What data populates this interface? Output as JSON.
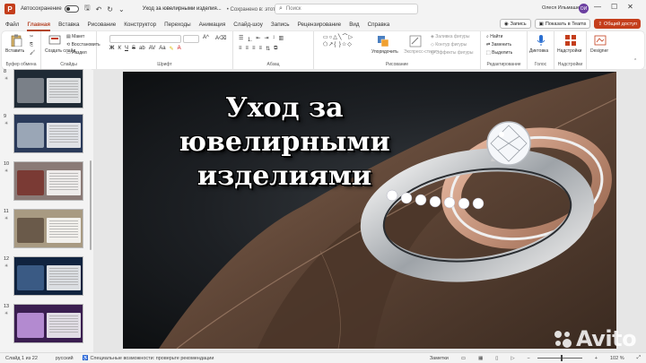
{
  "titlebar": {
    "autosave_label": "Автосохранение",
    "doc_title": "Уход за ювелирными изделия...",
    "save_state": "• Сохранено в: этот компьютер ∨",
    "search_placeholder": "Поиск",
    "user_name": "Олеся Ильмашенко",
    "avatar_initials": "ОИ"
  },
  "tabs": [
    "Файл",
    "Главная",
    "Вставка",
    "Рисование",
    "Конструктор",
    "Переходы",
    "Анимация",
    "Слайд-шоу",
    "Запись",
    "Рецензирование",
    "Вид",
    "Справка"
  ],
  "active_tab": "Главная",
  "top_buttons": {
    "record": "Запись",
    "present": "Показать в Teams",
    "share": "Общий доступ"
  },
  "ribbon": {
    "groups": {
      "clipboard": "Буфер обмена",
      "slides": "Слайды",
      "font": "Шрифт",
      "paragraph": "Абзац",
      "drawing": "Рисование",
      "editing": "Редактирование",
      "voice": "Голос",
      "addins": "Надстройки"
    },
    "paste": "Вставить",
    "new_slide": "Создать слайд",
    "layout": "Макет",
    "reset": "Восстановить",
    "section": "Раздел",
    "arrange": "Упорядочить",
    "quick_styles": "Экспресс-стили",
    "shape_fill": "Заливка фигуры",
    "shape_outline": "Контур фигуры",
    "shape_effects": "Эффекты фигуры",
    "find": "Найти",
    "replace": "Заменить",
    "select": "Выделить",
    "dictate": "Диктовка",
    "addins_btn": "Надстройки",
    "designer": "Designer"
  },
  "thumbnails": [
    {
      "num": "8",
      "bg": "#1f2a35",
      "pic": "#7a8088"
    },
    {
      "num": "9",
      "bg": "#2a3a5a",
      "pic": "#9aa6b6"
    },
    {
      "num": "10",
      "bg": "#8a7a76",
      "pic": "#7a3a34"
    },
    {
      "num": "11",
      "bg": "#a89a82",
      "pic": "#6a5a4a"
    },
    {
      "num": "12",
      "bg": "#10233f",
      "pic": "#3a5a84"
    },
    {
      "num": "13",
      "bg": "#3a1e50",
      "pic": "#b38ad0"
    }
  ],
  "slide": {
    "title_line1": "Уход за ювелирными",
    "title_line2": "изделиями"
  },
  "status": {
    "slide_counter": "Слайд 1 из 22",
    "language": "русский",
    "accessibility": "Специальные возможности: проверьте рекомендации",
    "notes": "Заметки",
    "zoom": "102 %"
  },
  "watermark": "Avito"
}
